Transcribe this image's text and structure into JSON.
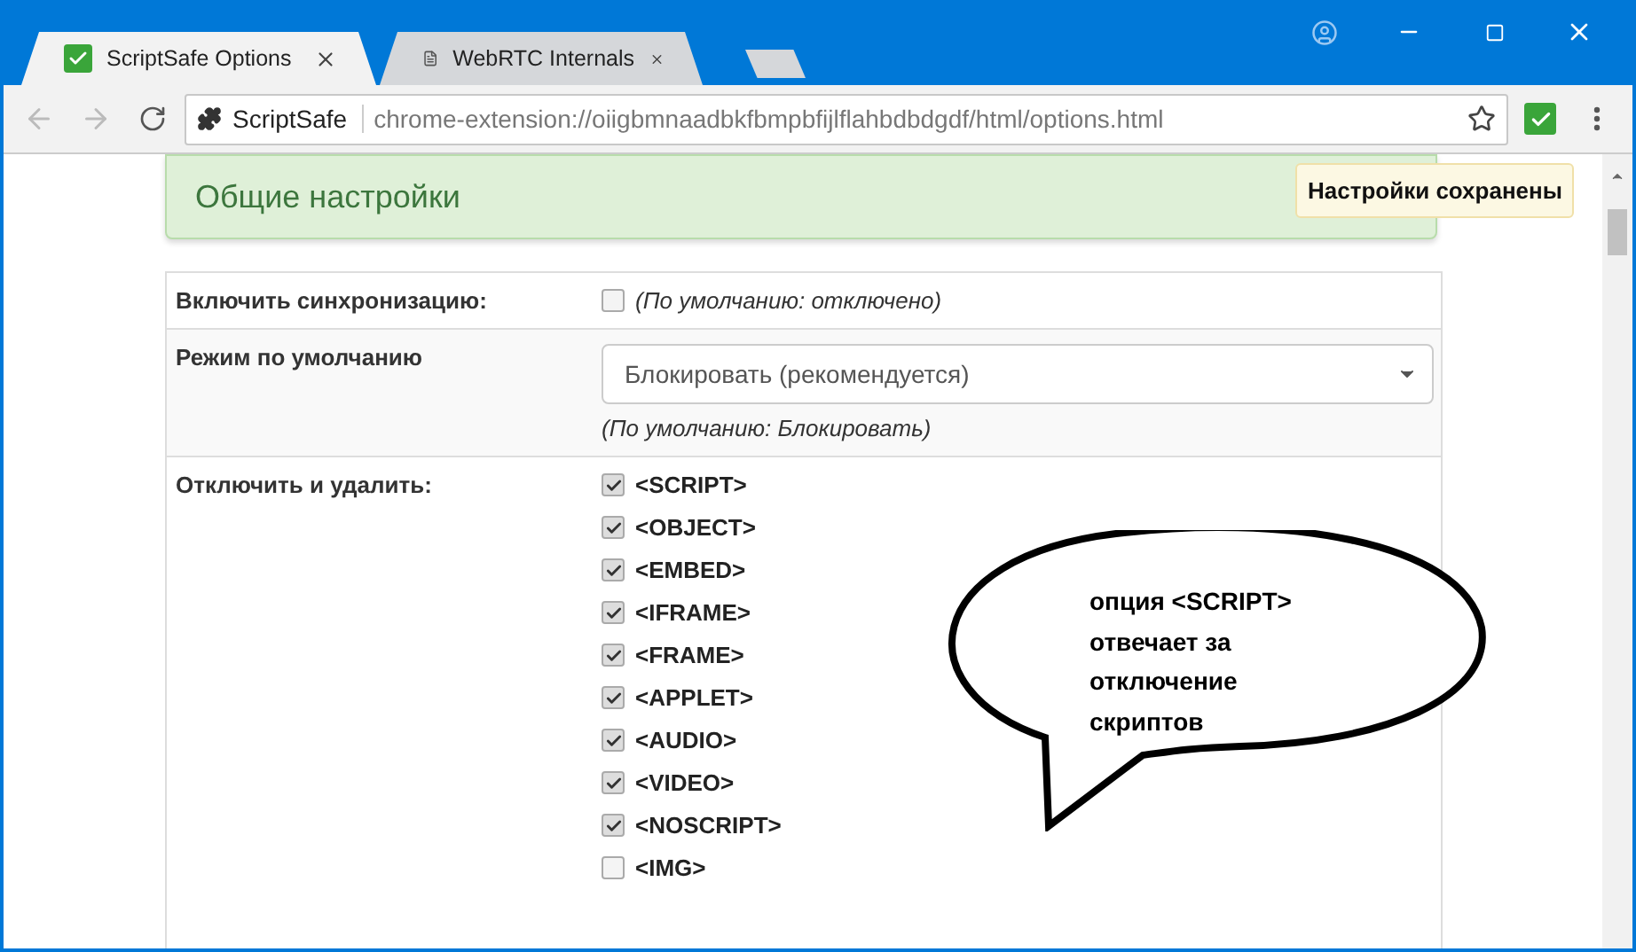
{
  "tabs": [
    {
      "title": "ScriptSafe Options",
      "selected": true,
      "kind": "extension"
    },
    {
      "title": "WebRTC Internals",
      "selected": false,
      "kind": "page"
    }
  ],
  "address_bar": {
    "site": "ScriptSafe",
    "url": "chrome-extension://oiigbmnaadbkfbmpbfijlflahbdbdgdf/html/options.html"
  },
  "header": "Общие настройки",
  "toast": "Настройки сохранены",
  "settings": [
    {
      "kind": "checkbox",
      "label": "Включить синхронизацию:",
      "checked": false,
      "hint": "(По умолчанию: отключено)"
    },
    {
      "kind": "select",
      "label": "Режим по умолчанию",
      "value": "Блокировать (рекомендуется)",
      "hint": "(По умолчанию: Блокировать)"
    },
    {
      "kind": "checklist",
      "label": "Отключить и удалить:",
      "options": [
        {
          "label": "<SCRIPT>",
          "checked": true
        },
        {
          "label": "<OBJECT>",
          "checked": true
        },
        {
          "label": "<EMBED>",
          "checked": true
        },
        {
          "label": "<IFRAME>",
          "checked": true
        },
        {
          "label": "<FRAME>",
          "checked": true
        },
        {
          "label": "<APPLET>",
          "checked": true
        },
        {
          "label": "<AUDIO>",
          "checked": true
        },
        {
          "label": "<VIDEO>",
          "checked": true
        },
        {
          "label": "<NOSCRIPT>",
          "checked": true
        },
        {
          "label": "<IMG>",
          "checked": false
        }
      ]
    }
  ],
  "callout": "опция <SCRIPT>\nотвечает за\nотключение\nскриптов"
}
